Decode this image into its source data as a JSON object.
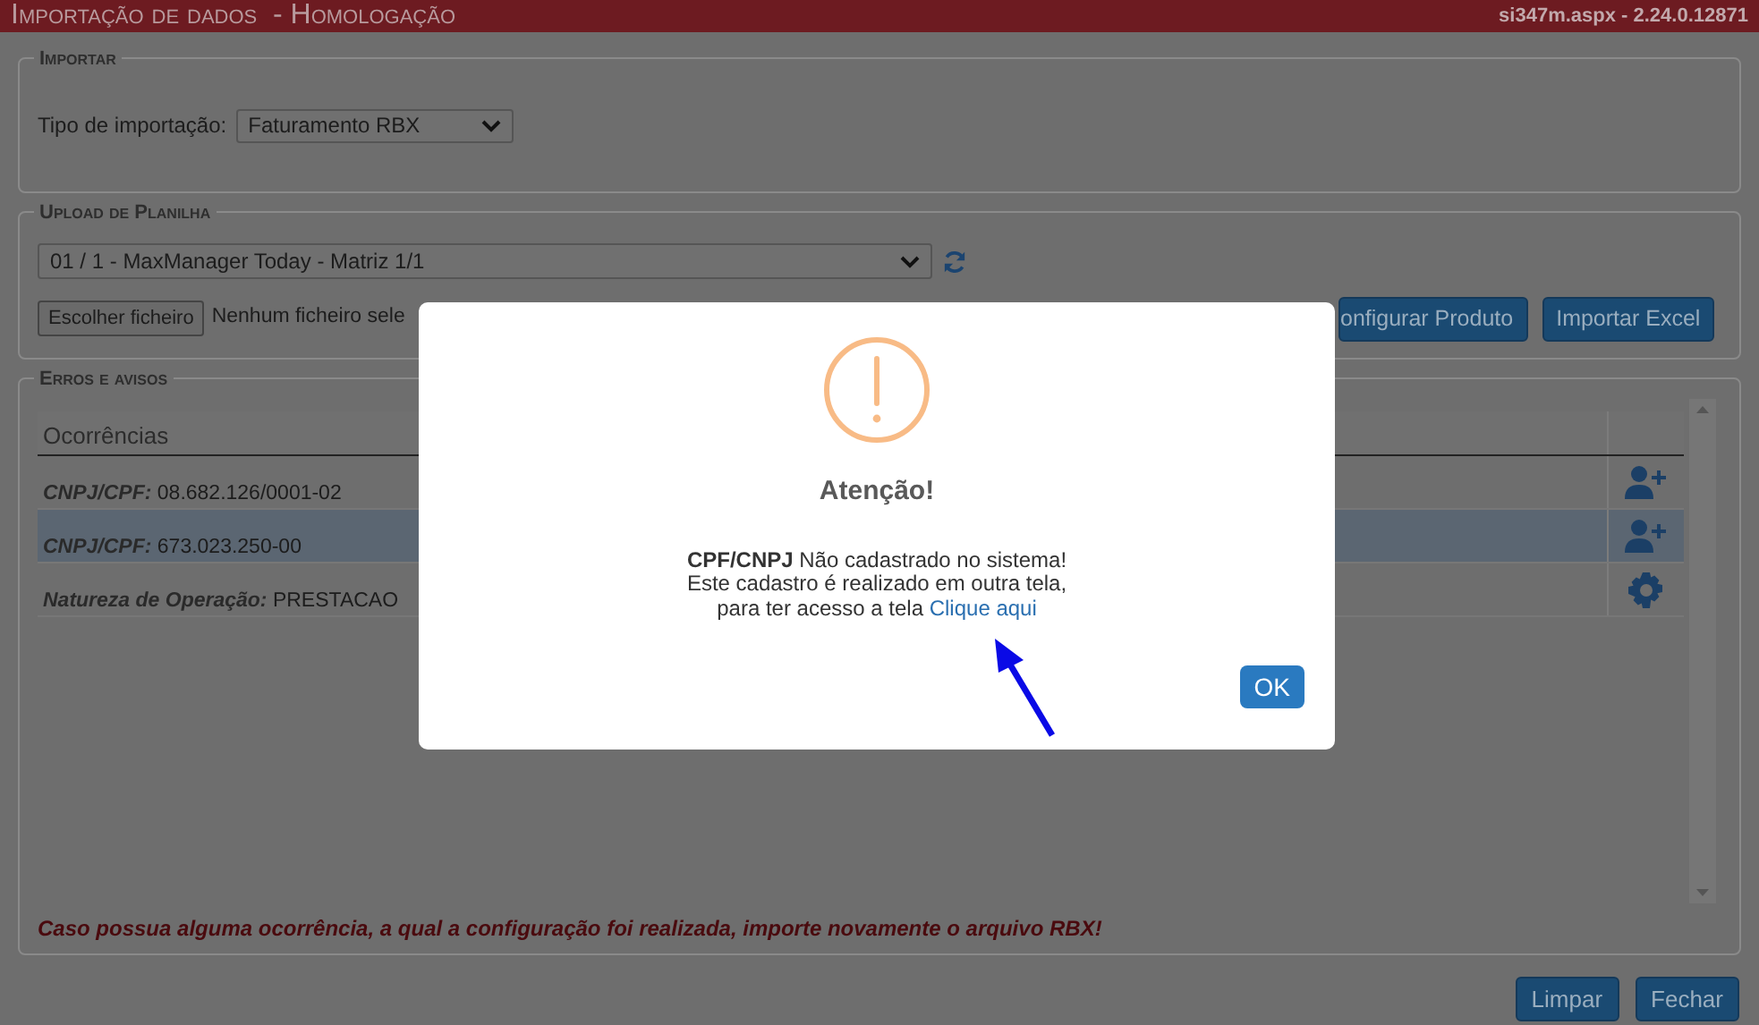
{
  "header": {
    "title": "Importação de dados  - Homologação",
    "version": "si347m.aspx - 2.24.0.12871"
  },
  "importar": {
    "legend": "Importar",
    "label": "Tipo de importação:",
    "select": "Faturamento RBX"
  },
  "upload": {
    "legend": "Upload de Planilha",
    "select": "01 / 1 - MaxManager Today - Matriz 1/1",
    "file_button": "Escolher ficheiro",
    "file_status": "Nenhum ficheiro sele",
    "buttons": [
      "onfigurar Produto",
      "Importar Excel"
    ]
  },
  "erros": {
    "legend": "Erros e avisos",
    "column": "Ocorrências",
    "rows": [
      {
        "label": "CNPJ/CPF:",
        "value": "08.682.126/0001-02",
        "selected": false,
        "kind": "add-person"
      },
      {
        "label": "CNPJ/CPF:",
        "value": "673.023.250-00",
        "selected": true,
        "kind": "add-person"
      },
      {
        "label": "Natureza de Operação:",
        "value": "PRESTACAO",
        "selected": false,
        "kind": "settings"
      }
    ],
    "note": "Caso possua alguma ocorrência, a qual a configuração foi realizada, importe novamente o arquivo RBX!"
  },
  "footer_buttons": [
    "Limpar",
    "Fechar"
  ],
  "dialog": {
    "title": "Atenção!",
    "message": "**CPF/CNPJ** Não cadastrado no sistema!\nEste cadastro é realizado em outra tela,\npara ter acesso a tela",
    "link": "Clique aqui",
    "ok": "OK"
  }
}
